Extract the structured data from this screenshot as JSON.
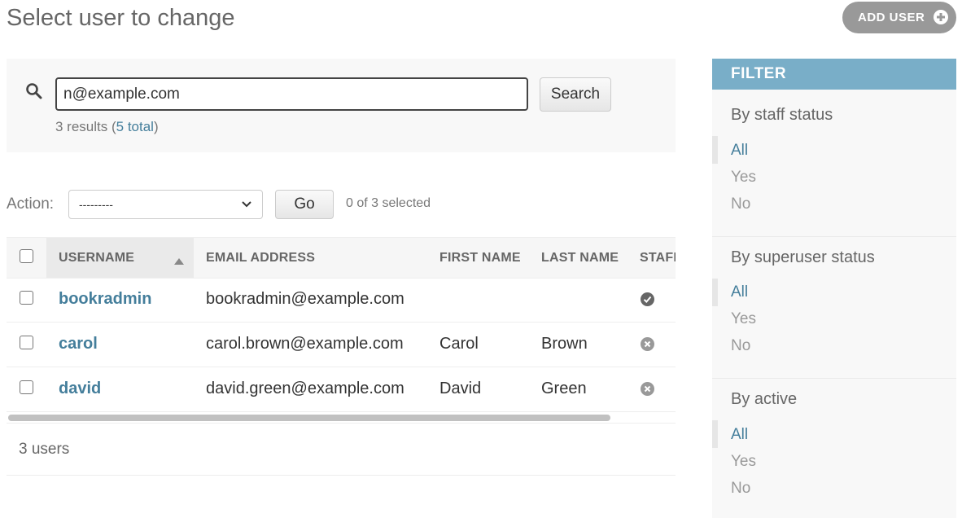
{
  "page": {
    "title": "Select user to change",
    "add_user_label": "ADD USER"
  },
  "search": {
    "value": "n@example.com",
    "button_label": "Search",
    "results_text": "3 results (",
    "total_link": "5 total",
    "results_suffix": ")"
  },
  "actions": {
    "label": "Action:",
    "selected_option": "---------",
    "go_label": "Go",
    "selected_count": "0 of 3 selected"
  },
  "table": {
    "columns": [
      "USERNAME",
      "EMAIL ADDRESS",
      "FIRST NAME",
      "LAST NAME",
      "STAFF"
    ],
    "rows": [
      {
        "username": "bookradmin",
        "email": "bookradmin@example.com",
        "first_name": "",
        "last_name": "",
        "staff": "yes"
      },
      {
        "username": "carol",
        "email": "carol.brown@example.com",
        "first_name": "Carol",
        "last_name": "Brown",
        "staff": "no"
      },
      {
        "username": "david",
        "email": "david.green@example.com",
        "first_name": "David",
        "last_name": "Green",
        "staff": "no"
      }
    ],
    "footer_count": "3 users"
  },
  "filter": {
    "title": "FILTER",
    "groups": [
      {
        "title": "By staff status",
        "options": [
          "All",
          "Yes",
          "No"
        ],
        "selected": "All"
      },
      {
        "title": "By superuser status",
        "options": [
          "All",
          "Yes",
          "No"
        ],
        "selected": "All"
      },
      {
        "title": "By active",
        "options": [
          "All",
          "Yes",
          "No"
        ],
        "selected": "All"
      }
    ]
  },
  "colors": {
    "accent": "#447e9b",
    "filter_header": "#79aec8",
    "add_user_button": "#999999",
    "icon_yes": "#666666",
    "icon_no": "#999999"
  },
  "icons": {
    "search": "search-icon",
    "add": "plus-icon",
    "sort": "sort-ascending-icon",
    "dropdown": "chevron-down-icon",
    "staff_yes": "check-circle-icon",
    "staff_no": "x-circle-icon"
  }
}
